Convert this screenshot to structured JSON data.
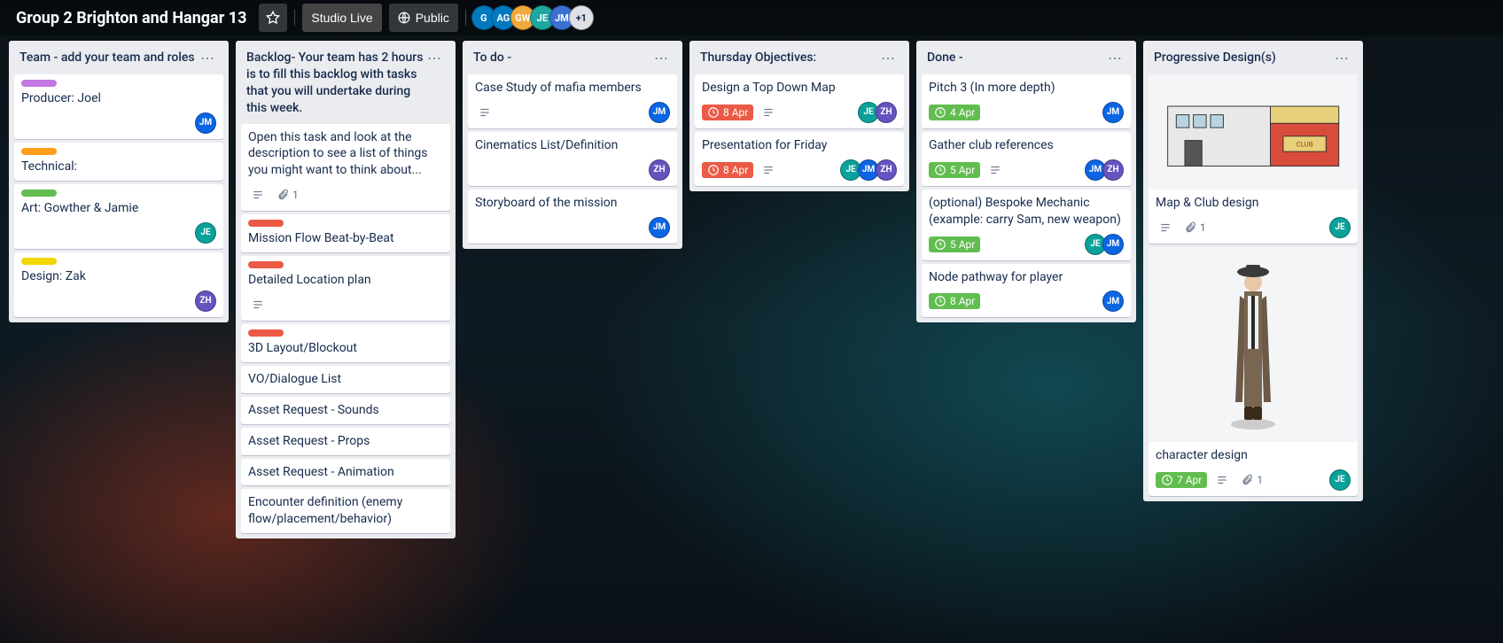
{
  "header": {
    "title": "Group 2 Brighton and Hangar 13",
    "team_label": "Studio Live",
    "visibility_label": "Public",
    "avatars": [
      {
        "initials": "G",
        "bg": "#0079bf"
      },
      {
        "initials": "AG",
        "bg": "#0079bf"
      },
      {
        "initials": "GW",
        "bg": "#f2a93b"
      },
      {
        "initials": "JE",
        "bg": "#1ea7a0"
      },
      {
        "initials": "JM",
        "bg": "#3b6fd4"
      }
    ],
    "avatar_overflow": "+1"
  },
  "member_colors": {
    "JM": "#0c66e4",
    "JE": "#0aa19a",
    "ZH": "#6554c0"
  },
  "label_colors": {
    "purple": "#c377e0",
    "orange": "#ff9f1a",
    "green": "#61bd4f",
    "yellow": "#f2d600",
    "red": "#eb5a46"
  },
  "lists": [
    {
      "title": "Team - add your team and roles",
      "cards": [
        {
          "labels": [
            "purple"
          ],
          "title": "Producer: Joel",
          "members": [
            "JM"
          ]
        },
        {
          "labels": [
            "orange"
          ],
          "title": "Technical:"
        },
        {
          "labels": [
            "green"
          ],
          "title": "Art: Gowther & Jamie",
          "members": [
            "JE"
          ]
        },
        {
          "labels": [
            "yellow"
          ],
          "title": "Design: Zak",
          "members": [
            "ZH"
          ]
        }
      ]
    },
    {
      "title": "Backlog- Your team has 2 hours is to fill this backlog with tasks that you will undertake during this week.",
      "cards": [
        {
          "title": "Open this task and look at the description to see a list of things you might want to think about...",
          "desc": true,
          "attach": "1"
        },
        {
          "labels": [
            "red"
          ],
          "title": "Mission Flow Beat-by-Beat"
        },
        {
          "labels": [
            "red"
          ],
          "title": "Detailed Location plan",
          "desc": true
        },
        {
          "labels": [
            "red"
          ],
          "title": "3D Layout/Blockout"
        },
        {
          "title": "VO/Dialogue List"
        },
        {
          "title": "Asset Request - Sounds"
        },
        {
          "title": "Asset Request - Props"
        },
        {
          "title": "Asset Request - Animation"
        },
        {
          "title": "Encounter definition (enemy flow/placement/behavior)"
        }
      ]
    },
    {
      "title": "To do -",
      "cards": [
        {
          "title": "Case Study of mafia members",
          "desc": true,
          "members": [
            "JM"
          ]
        },
        {
          "title": "Cinematics List/Definition",
          "members": [
            "ZH"
          ]
        },
        {
          "title": "Storyboard of the mission",
          "members": [
            "JM"
          ]
        }
      ]
    },
    {
      "title": "Thursday Objectives:",
      "cards": [
        {
          "title": "Design a Top Down Map",
          "date": "8 Apr",
          "due": true,
          "desc": true,
          "members": [
            "JE",
            "ZH"
          ]
        },
        {
          "title": "Presentation for Friday",
          "date": "8 Apr",
          "due": true,
          "desc": true,
          "members": [
            "JE",
            "JM",
            "ZH"
          ]
        }
      ]
    },
    {
      "title": "Done -",
      "cards": [
        {
          "title": "Pitch 3 (In more depth)",
          "date": "4 Apr",
          "members": [
            "JM"
          ]
        },
        {
          "title": "Gather club references",
          "date": "5 Apr",
          "desc": true,
          "members": [
            "JM",
            "ZH"
          ]
        },
        {
          "title": "(optional) Bespoke Mechanic (example: carry Sam, new weapon)",
          "date": "5 Apr",
          "members": [
            "JE",
            "JM"
          ]
        },
        {
          "title": "Node pathway for player",
          "date": "8 Apr",
          "members": [
            "JM"
          ]
        }
      ]
    },
    {
      "title": "Progressive Design(s)",
      "cards": [
        {
          "cover": "club",
          "title": "Map & Club design",
          "desc": true,
          "attach": "1",
          "members": [
            "JE"
          ]
        },
        {
          "cover": "character",
          "title": "character design",
          "date": "7 Apr",
          "desc": true,
          "attach": "1",
          "members": [
            "JE"
          ]
        }
      ]
    }
  ]
}
